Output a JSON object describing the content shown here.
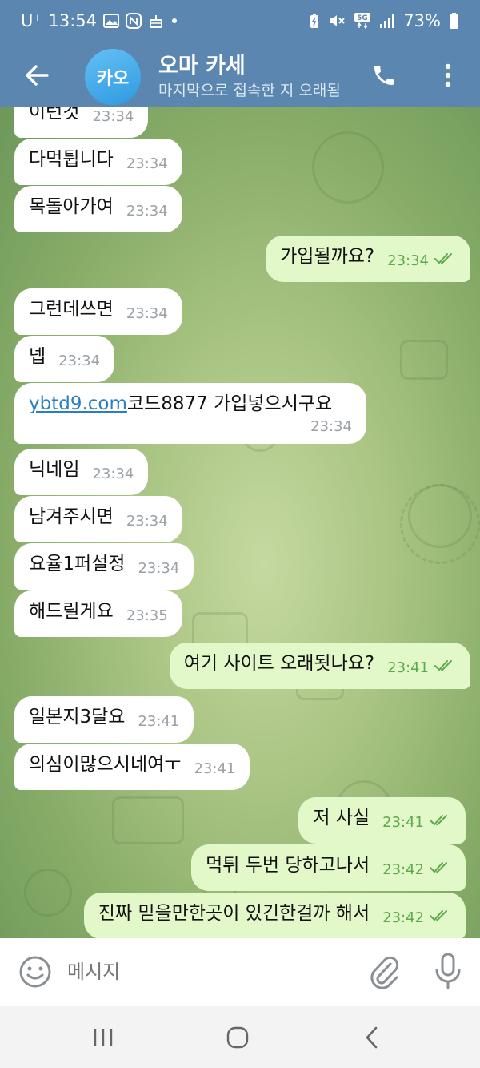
{
  "status": {
    "carrier": "U⁺",
    "time": "13:54",
    "battery": "73%",
    "network": "5G"
  },
  "header": {
    "avatar_text": "카오",
    "title": "오마 카세",
    "subtitle": "마지막으로 접속한 지 오래됨"
  },
  "messages": [
    {
      "dir": "in",
      "text": "이런것",
      "time": "23:34"
    },
    {
      "dir": "in",
      "text": "다먹튑니다",
      "time": "23:34"
    },
    {
      "dir": "in",
      "text": "목돌아가여",
      "time": "23:34"
    },
    {
      "dir": "out",
      "text": "가입될까요?",
      "time": "23:34"
    },
    {
      "dir": "in",
      "text": "그런데쓰면",
      "time": "23:34"
    },
    {
      "dir": "in",
      "text": "넵",
      "time": "23:34"
    },
    {
      "dir": "in",
      "link": "ybtd9.com",
      "text": " 코드8877 가입넣으시구요",
      "time": "23:34"
    },
    {
      "dir": "in",
      "text": "닉네임",
      "time": "23:34"
    },
    {
      "dir": "in",
      "text": "남겨주시면",
      "time": "23:34"
    },
    {
      "dir": "in",
      "text": "요율1퍼설정",
      "time": "23:34"
    },
    {
      "dir": "in",
      "text": "해드릴게요",
      "time": "23:35"
    },
    {
      "dir": "out",
      "text": "여기 사이트 오래됫나요?",
      "time": "23:41"
    },
    {
      "dir": "in",
      "text": "일본지3달요",
      "time": "23:41"
    },
    {
      "dir": "in",
      "text": "의심이많으시네여ㅜ",
      "time": "23:41"
    },
    {
      "dir": "out",
      "text": "저 사실",
      "time": "23:41"
    },
    {
      "dir": "out",
      "text": "먹튀 두번 당하고나서",
      "time": "23:42"
    },
    {
      "dir": "out",
      "text": "진짜 믿을만한곳이 있긴한걸까 해서",
      "time": "23:42"
    }
  ],
  "input": {
    "placeholder": "메시지"
  },
  "colors": {
    "header": "#5a86b0",
    "incoming_bubble": "#ffffff",
    "outgoing_bubble": "#e3f8c9",
    "read_check": "#5caa4e",
    "link": "#2c7fbf"
  },
  "icons": {
    "back": "arrow-left-icon",
    "call": "phone-icon",
    "more": "more-vertical-icon",
    "emoji": "smiley-icon",
    "attach": "paperclip-icon",
    "mic": "microphone-icon"
  }
}
